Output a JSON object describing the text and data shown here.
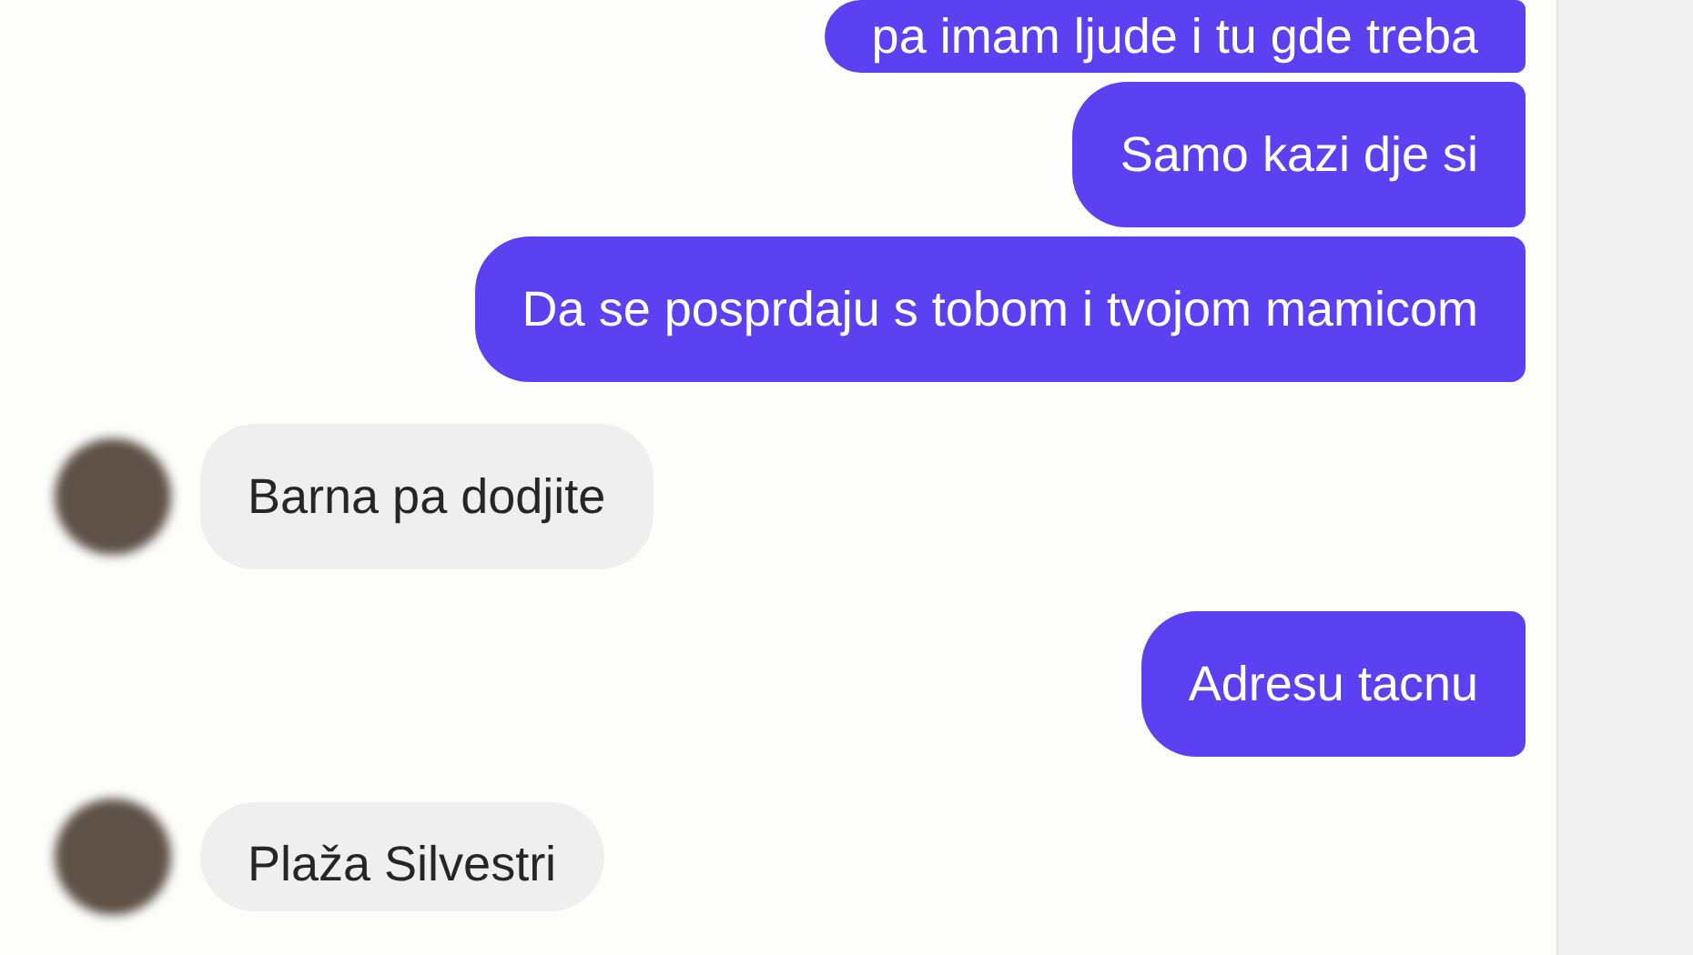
{
  "messages": [
    {
      "kind": "sent",
      "text": "pa imam ljude i tu gde treba"
    },
    {
      "kind": "sent",
      "text": "Samo kazi dje si"
    },
    {
      "kind": "sent",
      "text": "Da se posprdaju s tobom i tvojom mamicom"
    },
    {
      "kind": "received",
      "text": "Barna pa dodjite"
    },
    {
      "kind": "sent",
      "text": "Adresu tacnu"
    },
    {
      "kind": "received",
      "text": "Plaža Silvestri"
    }
  ]
}
